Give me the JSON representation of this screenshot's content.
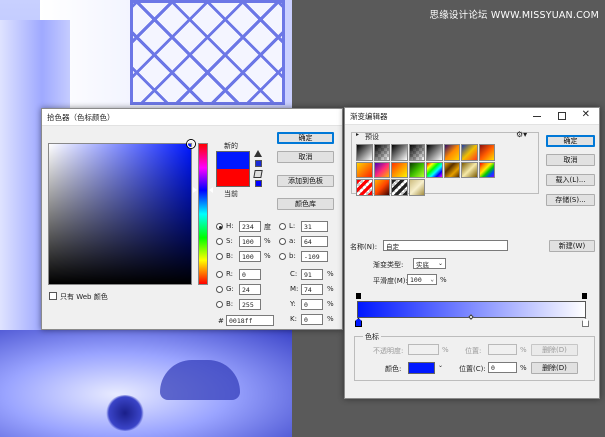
{
  "watermark": "思缘设计论坛 WWW.MISSYUAN.COM",
  "picker": {
    "title": "拾色器（色标颜色）",
    "ok": "确定",
    "cancel": "取消",
    "add_swatch": "添加到色板",
    "color_lib": "颜色库",
    "new_label": "新的",
    "current_label": "当前",
    "web_only": "只有 Web 颜色",
    "new_color": "#0018ff",
    "current_color": "#ff0000",
    "hue_color": "#0018ff",
    "fields": {
      "H": {
        "label": "H:",
        "value": "234",
        "unit": "度"
      },
      "S": {
        "label": "S:",
        "value": "100",
        "unit": "%"
      },
      "B": {
        "label": "B:",
        "value": "100",
        "unit": "%"
      },
      "R": {
        "label": "R:",
        "value": "0"
      },
      "G": {
        "label": "G:",
        "value": "24"
      },
      "Bl": {
        "label": "B:",
        "value": "255"
      },
      "L": {
        "label": "L:",
        "value": "31"
      },
      "a": {
        "label": "a:",
        "value": "64"
      },
      "b": {
        "label": "b:",
        "value": "-109"
      },
      "C": {
        "label": "C:",
        "value": "91",
        "unit": "%"
      },
      "M": {
        "label": "M:",
        "value": "74",
        "unit": "%"
      },
      "Y": {
        "label": "Y:",
        "value": "0",
        "unit": "%"
      },
      "K": {
        "label": "K:",
        "value": "0",
        "unit": "%"
      },
      "hex": {
        "label": "#",
        "value": "0018ff"
      }
    }
  },
  "gradient": {
    "title": "渐变编辑器",
    "presets_label": "预设",
    "ok": "确定",
    "cancel": "取消",
    "load": "载入(L)...",
    "save": "存储(S)...",
    "name_label": "名称(N):",
    "name_value": "自定",
    "new_button": "新建(W)",
    "type_label": "渐变类型:",
    "type_value": "实底",
    "smooth_label": "平滑度(M):",
    "smooth_value": "100",
    "smooth_unit": "%",
    "stops_label": "色标",
    "opacity_label": "不透明度:",
    "opacity_unit": "%",
    "location_label": "位置:",
    "location_unit": "%",
    "delete_label": "删除(D)",
    "color_label": "颜色:",
    "color_swatch": "#0018ff",
    "location_c_label": "位置(C):",
    "location_c_value": "0",
    "location_c_unit": "%",
    "delete_c_label": "删除(D)",
    "bar_from": "#0018ff",
    "bar_to": "#ffffff",
    "presets": [
      "linear-gradient(135deg,#000 0%,#fff 100%)",
      "linear-gradient(135deg,#000 0%,transparent 100%),repeating-conic-gradient(#ccc 0 25%,#fff 0 50%) 0 0/6px 6px",
      "linear-gradient(135deg,#000 0%,#fff 100%)",
      "linear-gradient(135deg,#000 0%,transparent 100%),repeating-conic-gradient(#ccc 0 25%,#fff 0 50%) 0 0/6px 6px",
      "linear-gradient(135deg,#000 0%,#fff 100%)",
      "linear-gradient(135deg,#2a0a6b,#ff8a00,#ffd400)",
      "linear-gradient(135deg,#1b3aa8,#f0c000,#ff3b1e)",
      "linear-gradient(135deg,#8b1010,#ff5a00,#ffdd00)",
      "linear-gradient(135deg,#ffd000,#ff7a00,#ff2200)",
      "linear-gradient(135deg,#4c00b5,#ff2a7a,#ffb000)",
      "linear-gradient(135deg,#ff3300,#ff9900,#fff200)",
      "linear-gradient(135deg,#0a3d00,#3fbf00,#b5ff30)",
      "linear-gradient(135deg,#ff0000,#ffff00,#00ff00,#00ffff,#0000ff,#ff00ff)",
      "linear-gradient(135deg,#e6a000,#5a3000,#e6a000,#5a3000)",
      "linear-gradient(135deg,#7a5a00,#f5e9a8,#7a5a00)",
      "linear-gradient(135deg,#ff0000,#ff8800,#ffee00,#00cc00,#0044ff,#8800ff)",
      "repeating-linear-gradient(135deg,#ff0000 0 3px,transparent 3px 6px),repeating-conic-gradient(#ccc 0 25%,#fff 0 50%) 0 0/6px 6px",
      "linear-gradient(135deg,#ffb000,#ff4400,#3a0000)",
      "repeating-linear-gradient(135deg,#222 0 3px,transparent 3px 6px),repeating-conic-gradient(#ccc 0 25%,#fff 0 50%) 0 0/6px 6px",
      "linear-gradient(135deg,#cdbd80,#f7efcc,#a38d40)"
    ]
  }
}
